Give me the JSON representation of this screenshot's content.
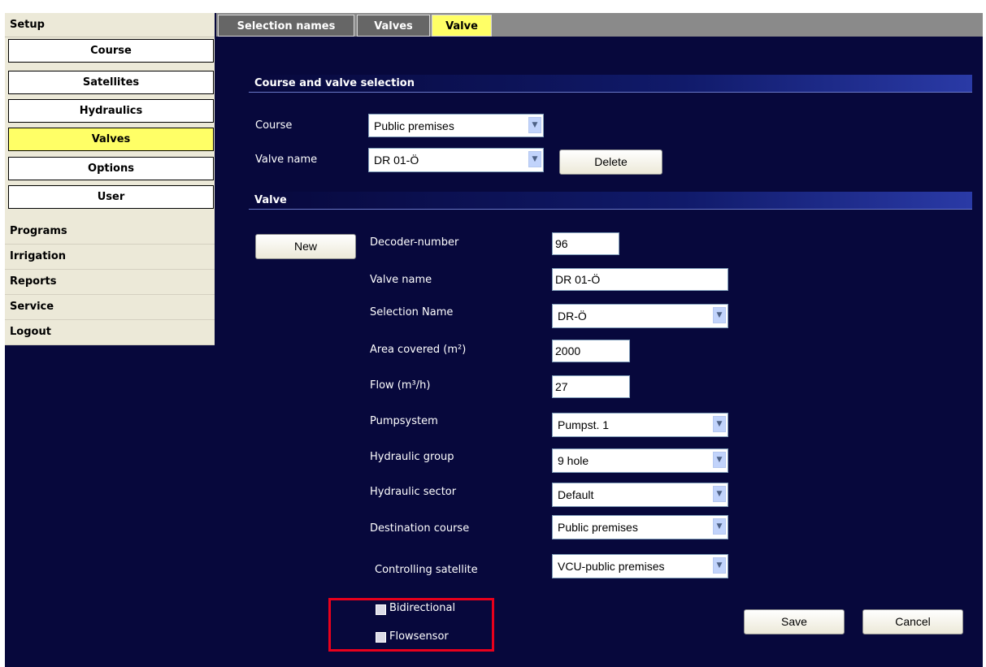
{
  "sidebar": {
    "setup": "Setup",
    "subitems": [
      {
        "label": "Course"
      },
      {
        "label": "Satellites"
      },
      {
        "label": "Hydraulics"
      },
      {
        "label": "Valves"
      },
      {
        "label": "Options"
      },
      {
        "label": "User"
      }
    ],
    "active_subitem": "Valves",
    "main_items": [
      {
        "label": "Programs"
      },
      {
        "label": "Irrigation"
      },
      {
        "label": "Reports"
      },
      {
        "label": "Service"
      },
      {
        "label": "Logout"
      }
    ]
  },
  "tabs": [
    {
      "label": "Selection names"
    },
    {
      "label": "Valves"
    },
    {
      "label": "Valve"
    }
  ],
  "active_tab": "Valve",
  "selection_section": {
    "title": "Course and valve selection",
    "course_label": "Course",
    "course_value": "Public premises",
    "valve_name_label": "Valve name",
    "valve_name_value": "DR 01-Ö",
    "delete_label": "Delete"
  },
  "valve_section": {
    "title": "Valve",
    "new_label": "New",
    "decoder_label": "Decoder-number",
    "decoder_value": "96",
    "valve_name_label": "Valve name",
    "valve_name_value": "DR 01-Ö",
    "selection_name_label": "Selection Name",
    "selection_name_value": "DR-Ö",
    "area_label": "Area covered (m²)",
    "area_value": "2000",
    "flow_label": "Flow (m³/h)",
    "flow_value": "27",
    "pumpsystem_label": "Pumpsystem",
    "pumpsystem_value": "Pumpst. 1",
    "hydraulic_group_label": "Hydraulic group",
    "hydraulic_group_value": "9 hole",
    "hydraulic_sector_label": "Hydraulic sector",
    "hydraulic_sector_value": "Default",
    "destination_label": "Destination course",
    "destination_value": "Public premises",
    "satellite_label": "Controlling satellite",
    "satellite_value": "VCU-public premises",
    "bidirectional_label": "Bidirectional",
    "bidirectional_checked": false,
    "flowsensor_label": "Flowsensor",
    "flowsensor_checked": false,
    "save_label": "Save",
    "cancel_label": "Cancel"
  },
  "icons": {
    "dropdown": "chevron-down-icon",
    "checkbox": "checkbox-icon"
  },
  "colors": {
    "background": "#07083c",
    "highlight_active": "#ffff66",
    "annotation_border": "#e8001c"
  }
}
